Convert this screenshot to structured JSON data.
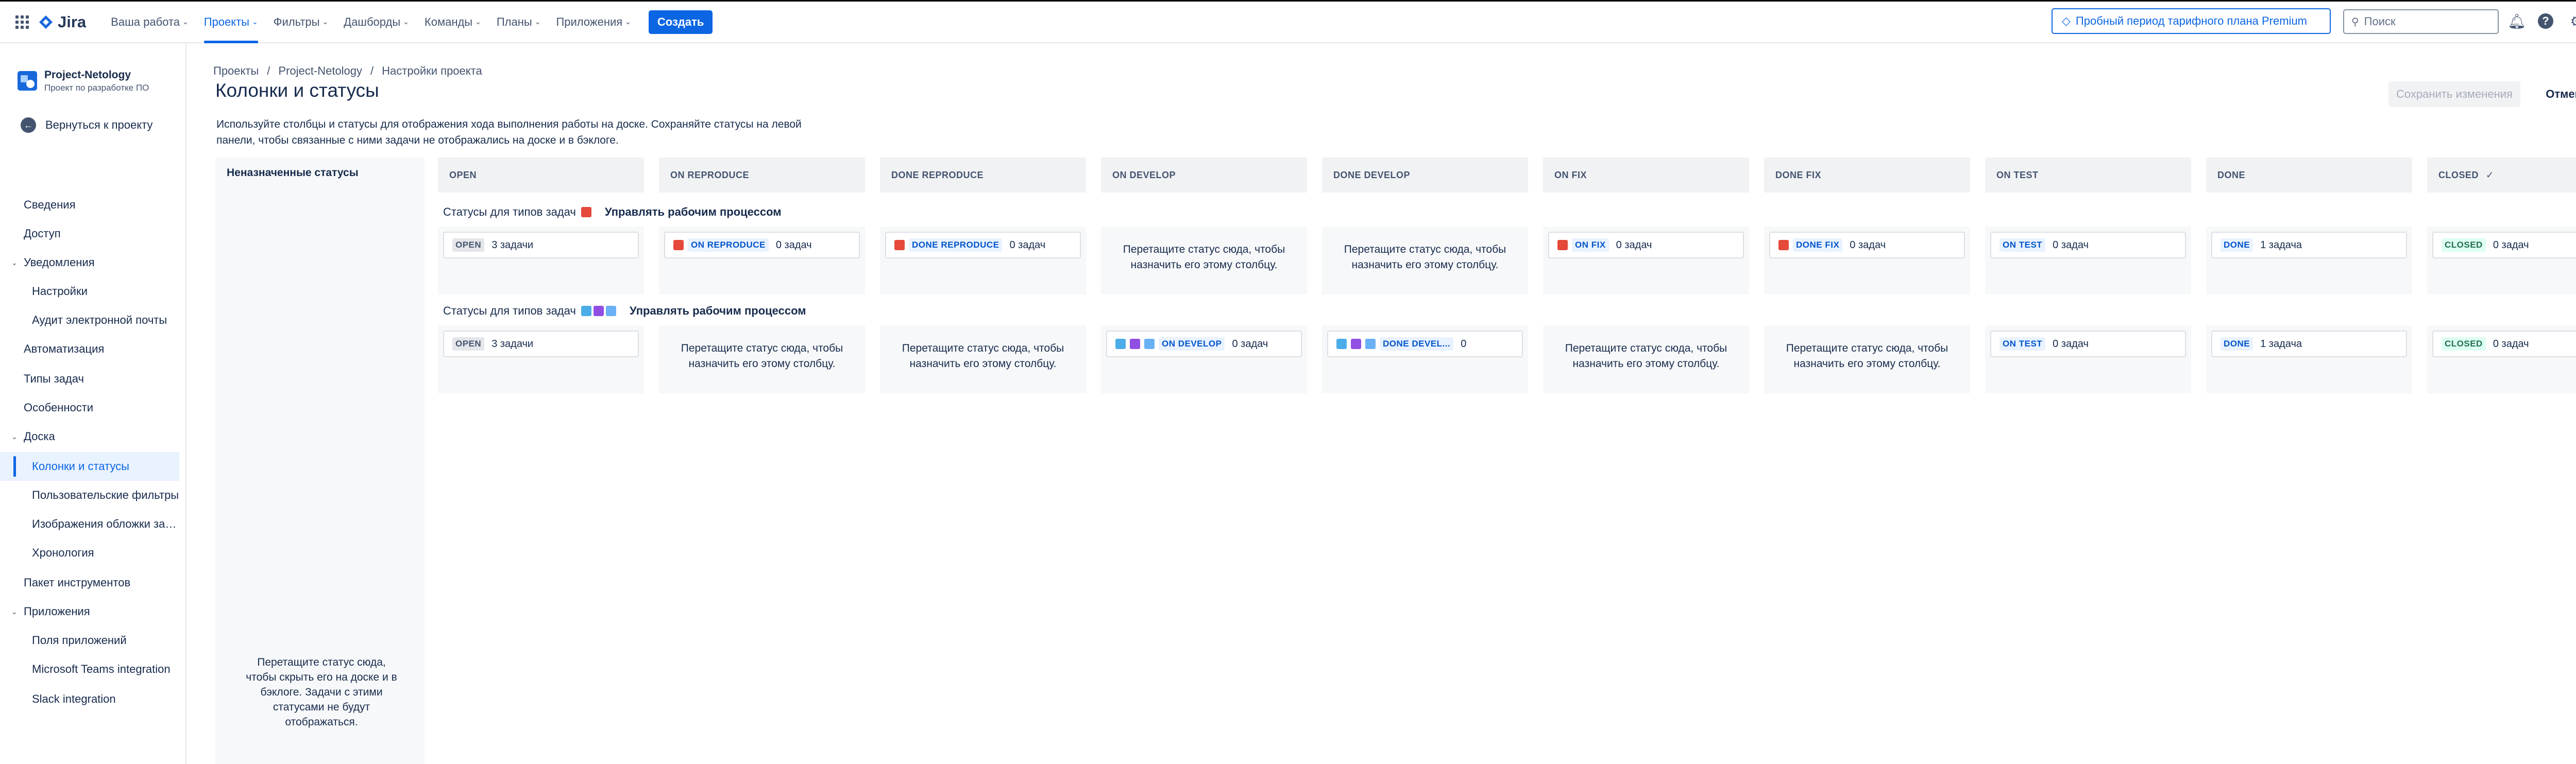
{
  "topbar": {
    "logo_text": "Jira",
    "nav": [
      {
        "label": "Ваша работа",
        "active": false
      },
      {
        "label": "Проекты",
        "active": true
      },
      {
        "label": "Фильтры",
        "active": false
      },
      {
        "label": "Дашборды",
        "active": false
      },
      {
        "label": "Команды",
        "active": false
      },
      {
        "label": "Планы",
        "active": false
      },
      {
        "label": "Приложения",
        "active": false
      }
    ],
    "create_label": "Создать",
    "premium_label": "Пробный период тарифного плана Premium",
    "search_placeholder": "Поиск",
    "avatar_initial": "E"
  },
  "sidebar": {
    "project_name": "Project-Netology",
    "project_type": "Проект по разработке ПО",
    "back_label": "Вернуться к проекту",
    "items": [
      {
        "label": "Сведения",
        "kind": "l1"
      },
      {
        "label": "Доступ",
        "kind": "l1"
      },
      {
        "label": "Уведомления",
        "kind": "grp"
      },
      {
        "label": "Настройки",
        "kind": "l2"
      },
      {
        "label": "Аудит электронной почты",
        "kind": "l2"
      },
      {
        "label": "Автоматизация",
        "kind": "l1"
      },
      {
        "label": "Типы задач",
        "kind": "l1"
      },
      {
        "label": "Особенности",
        "kind": "l1"
      },
      {
        "label": "Доска",
        "kind": "grp"
      },
      {
        "label": "Колонки и статусы",
        "kind": "l2",
        "active": true
      },
      {
        "label": "Пользовательские фильтры",
        "kind": "l2"
      },
      {
        "label": "Изображения обложки задач",
        "kind": "l2"
      },
      {
        "label": "Хронология",
        "kind": "l2"
      },
      {
        "label": "Пакет инструментов",
        "kind": "l1"
      },
      {
        "label": "Приложения",
        "kind": "grp"
      },
      {
        "label": "Поля приложений",
        "kind": "l2"
      },
      {
        "label": "Microsoft Teams integration",
        "kind": "l2"
      },
      {
        "label": "Slack integration",
        "kind": "l2"
      }
    ]
  },
  "breadcrumbs": [
    "Проекты",
    "Project-Netology",
    "Настройки проекта"
  ],
  "page_title": "Колонки и статусы",
  "save_label": "Сохранить изменения",
  "cancel_label": "Отменить",
  "description": "Используйте столбцы и статусы для отображения хода выполнения работы на доске. Сохраняйте статусы на левой панели, чтобы связанные с ними задачи не отображались на доске и в бэклоге.",
  "unassigned": {
    "title": "Неназначенные статусы",
    "drop_text": "Перетащите статус сюда, чтобы скрыть его на доске и в бэклоге. Задачи с этими статусами не будут отображаться."
  },
  "columns": [
    "OPEN",
    "ON REPRODUCE",
    "DONE REPRODUCE",
    "ON DEVELOP",
    "DONE DEVELOP",
    "ON FIX",
    "DONE FIX",
    "ON TEST",
    "DONE",
    "CLOSED"
  ],
  "closed_check": "✓",
  "rows": [
    {
      "label": "Статусы для типов задач",
      "icons": [
        "red"
      ],
      "manage": "Управлять рабочим процессом",
      "cells": [
        {
          "status": "OPEN",
          "color": "grey",
          "count": "3 задачи"
        },
        {
          "status": "ON REPRODUCE",
          "color": "blue",
          "count": "0 задач",
          "icons": [
            "red"
          ]
        },
        {
          "status": "DONE REPRODUCE",
          "color": "blue",
          "count": "0 задач",
          "icons": [
            "red"
          ]
        },
        {
          "drop": "Перетащите статус сюда, чтобы назначить его этому столбцу."
        },
        {
          "drop": "Перетащите статус сюда, чтобы назначить его этому столбцу."
        },
        {
          "status": "ON FIX",
          "color": "blue",
          "count": "0 задач",
          "icons": [
            "red"
          ]
        },
        {
          "status": "DONE FIX",
          "color": "blue",
          "count": "0 задач",
          "icons": [
            "red"
          ]
        },
        {
          "status": "ON TEST",
          "color": "blue",
          "count": "0 задач"
        },
        {
          "status": "DONE",
          "color": "blue",
          "count": "1 задача"
        },
        {
          "status": "CLOSED",
          "color": "green",
          "count": "0 задач"
        }
      ]
    },
    {
      "label": "Статусы для типов задач",
      "icons": [
        "blue",
        "purple",
        "lblue"
      ],
      "manage": "Управлять рабочим процессом",
      "cells": [
        {
          "status": "OPEN",
          "color": "grey",
          "count": "3 задачи"
        },
        {
          "drop": "Перетащите статус сюда, чтобы назначить его этому столбцу."
        },
        {
          "drop": "Перетащите статус сюда, чтобы назначить его этому столбцу."
        },
        {
          "status": "ON DEVELOP",
          "color": "blue",
          "count": "0 задач",
          "icons": [
            "blue",
            "purple",
            "lblue"
          ]
        },
        {
          "status": "DONE DEVEL...",
          "color": "blue",
          "count": "0",
          "icons": [
            "blue",
            "purple",
            "lblue"
          ]
        },
        {
          "drop": "Перетащите статус сюда, чтобы назначить его этому столбцу."
        },
        {
          "drop": "Перетащите статус сюда, чтобы назначить его этому столбцу."
        },
        {
          "status": "ON TEST",
          "color": "blue",
          "count": "0 задач"
        },
        {
          "status": "DONE",
          "color": "blue",
          "count": "1 задача"
        },
        {
          "status": "CLOSED",
          "color": "green",
          "count": "0 задач"
        }
      ]
    }
  ]
}
